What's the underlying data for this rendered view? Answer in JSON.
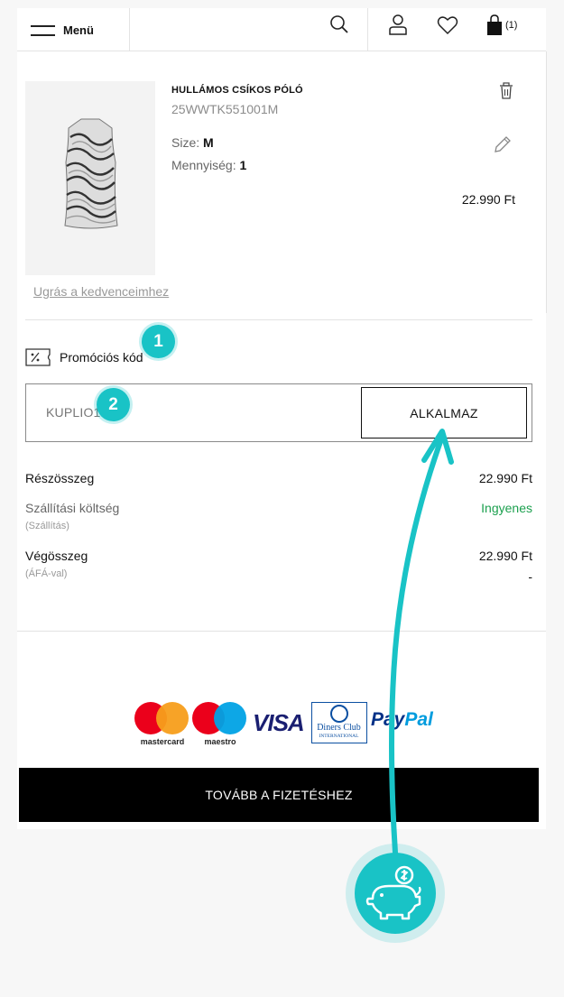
{
  "header": {
    "menu_label": "Menü",
    "cart_count": "(1)"
  },
  "product": {
    "name": "HULLÁMOS CSÍKOS PÓLÓ",
    "sku": "25WWTK551001M",
    "size_label": "Size:",
    "size_value": "M",
    "qty_label": "Mennyiség:",
    "qty_value": "1",
    "price": "22.990 Ft",
    "favorites_link": "Ugrás a kedvenceimhez"
  },
  "promo": {
    "label": "Promóciós kód",
    "code": "KUPLIO10",
    "apply_label": "ALKALMAZ",
    "step1": "1",
    "step2": "2"
  },
  "totals": {
    "subtotal_label": "Részösszeg",
    "subtotal_value": "22.990 Ft",
    "shipping_label": "Szállítási költség",
    "shipping_sub": "(Szállítás)",
    "shipping_value": "Ingyenes",
    "total_label": "Végösszeg",
    "total_sub": "(ÁFÁ-val)",
    "total_value": "22.990 Ft",
    "total_extra": "-"
  },
  "payment": {
    "mastercard": "mastercard",
    "maestro": "maestro",
    "visa": "VISA",
    "diners_1": "Diners Club",
    "diners_2": "INTERNATIONAL",
    "paypal_1": "Pay",
    "paypal_2": "Pal"
  },
  "checkout_label": "TOVÁBB A FIZETÉSHEZ",
  "colors": {
    "accent": "#19c3c6",
    "free_shipping": "#1ca04f",
    "checkout_bg": "#000000"
  }
}
